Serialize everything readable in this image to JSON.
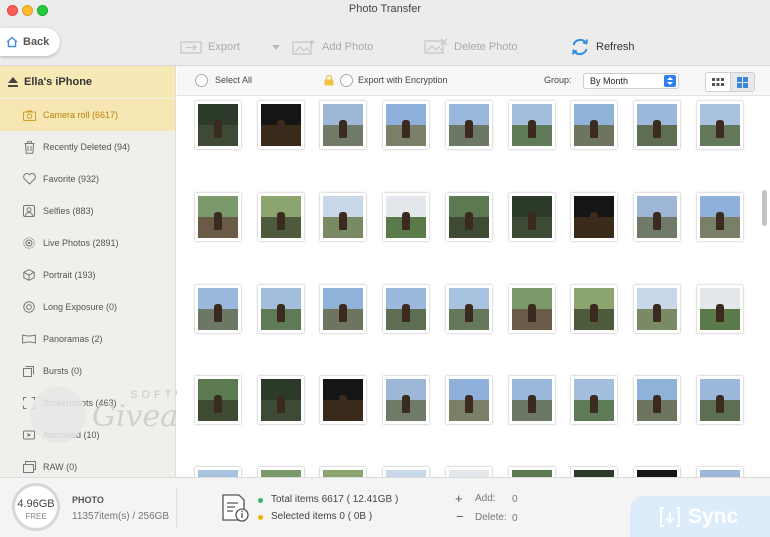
{
  "window": {
    "title": "Photo Transfer"
  },
  "toolbar": {
    "back_label": "Back",
    "export_label": "Export",
    "add_photo_label": "Add Photo",
    "delete_photo_label": "Delete Photo",
    "refresh_label": "Refresh"
  },
  "sidebar": {
    "device_name": "Ella's iPhone",
    "items": [
      {
        "label": "Camera roll (6617)",
        "icon": "camera-icon",
        "active": true
      },
      {
        "label": "Recently Deleted (94)",
        "icon": "trash-icon",
        "active": false
      },
      {
        "label": "Favorite (932)",
        "icon": "heart-icon",
        "active": false
      },
      {
        "label": "Selfies (883)",
        "icon": "selfie-icon",
        "active": false
      },
      {
        "label": "Live Photos (2891)",
        "icon": "live-photo-icon",
        "active": false
      },
      {
        "label": "Portrait (193)",
        "icon": "cube-icon",
        "active": false
      },
      {
        "label": "Long Exposure (0)",
        "icon": "long-exposure-icon",
        "active": false
      },
      {
        "label": "Panoramas (2)",
        "icon": "panorama-icon",
        "active": false
      },
      {
        "label": "Bursts (0)",
        "icon": "bursts-icon",
        "active": false
      },
      {
        "label": "Screenshots (463)",
        "icon": "screenshot-icon",
        "active": false
      },
      {
        "label": "Animated (10)",
        "icon": "animated-icon",
        "active": false
      },
      {
        "label": "RAW (0)",
        "icon": "raw-icon",
        "active": false
      }
    ]
  },
  "options": {
    "select_all_label": "Select All",
    "export_encryption_label": "Export with Encryption",
    "group_label": "Group:",
    "group_value": "By Month"
  },
  "footer": {
    "storage_size": "4.96GB",
    "storage_free_label": "FREE",
    "type_label": "PHOTO",
    "count_text": "11357item(s) / 256GB",
    "total_text": "Total items 6617 ( 12.41GB )",
    "selected_text": "Selected items 0 ( 0B )",
    "add_label": "Add:",
    "add_value": "0",
    "delete_label": "Delete:",
    "delete_value": "0",
    "sync_label": "Sync"
  },
  "watermark": {
    "top_text": "SOFTWA",
    "main_text": "Giveaway"
  },
  "colors": {
    "accent": "#f5e6b2",
    "active_text": "#b8860b",
    "sync": "#dcecfa",
    "total_dot": "#3cb371",
    "selected_dot": "#f0b400"
  }
}
